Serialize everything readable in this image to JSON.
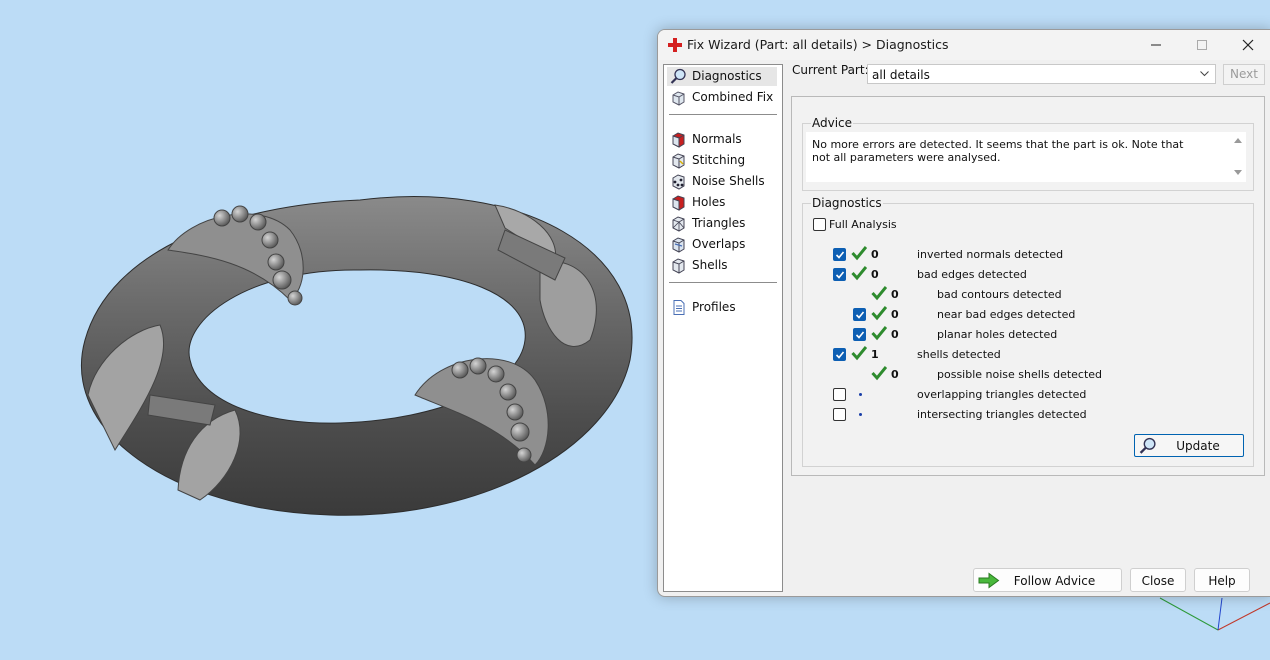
{
  "window": {
    "title": "Fix Wizard (Part: all details) > Diagnostics"
  },
  "sidebar": {
    "items": [
      {
        "label": "Diagnostics",
        "icon": "magnifier-icon",
        "selected": true
      },
      {
        "label": "Combined Fix",
        "icon": "combined-fix-icon"
      },
      {
        "label": "Normals",
        "icon": "normals-icon"
      },
      {
        "label": "Stitching",
        "icon": "stitching-icon"
      },
      {
        "label": "Noise Shells",
        "icon": "noise-shells-icon"
      },
      {
        "label": "Holes",
        "icon": "holes-icon"
      },
      {
        "label": "Triangles",
        "icon": "triangles-icon"
      },
      {
        "label": "Overlaps",
        "icon": "overlaps-icon"
      },
      {
        "label": "Shells",
        "icon": "shells-icon"
      },
      {
        "label": "Profiles",
        "icon": "document-icon"
      }
    ]
  },
  "current_part": {
    "label": "Current Part:",
    "value": "all details",
    "next_label": "Next"
  },
  "advice": {
    "title": "Advice",
    "text": "No more errors are detected. It seems that the part is ok. Note that not all parameters were analysed."
  },
  "diagnostics": {
    "title": "Diagnostics",
    "full_analysis_label": "Full Analysis",
    "full_analysis_checked": false,
    "rows": [
      {
        "checkbox": true,
        "checked": true,
        "status": "ok",
        "count": "0",
        "text": "inverted normals detected",
        "indent": 0
      },
      {
        "checkbox": true,
        "checked": true,
        "status": "ok",
        "count": "0",
        "text": "bad edges detected",
        "indent": 0
      },
      {
        "checkbox": false,
        "checked": false,
        "status": "ok",
        "count": "0",
        "text": "bad contours detected",
        "indent": 1
      },
      {
        "checkbox": true,
        "checked": true,
        "status": "ok",
        "count": "0",
        "text": "near bad edges detected",
        "indent": 1
      },
      {
        "checkbox": true,
        "checked": true,
        "status": "ok",
        "count": "0",
        "text": "planar holes detected",
        "indent": 1
      },
      {
        "checkbox": true,
        "checked": true,
        "status": "ok",
        "count": "1",
        "text": "shells detected",
        "indent": 0
      },
      {
        "checkbox": false,
        "checked": false,
        "status": "ok",
        "count": "0",
        "text": "possible noise shells detected",
        "indent": 1
      },
      {
        "checkbox": true,
        "checked": false,
        "status": "not-run",
        "count": "",
        "text": "overlapping triangles detected",
        "indent": 0
      },
      {
        "checkbox": true,
        "checked": false,
        "status": "not-run",
        "count": "",
        "text": "intersecting triangles detected",
        "indent": 0
      }
    ],
    "update_label": "Update"
  },
  "footer": {
    "follow_advice_label": "Follow Advice",
    "close_label": "Close",
    "help_label": "Help"
  },
  "colors": {
    "viewport_background": "#bcdcf6",
    "ok_check": "#2e8b2e",
    "accent": "#0d5fb3"
  }
}
